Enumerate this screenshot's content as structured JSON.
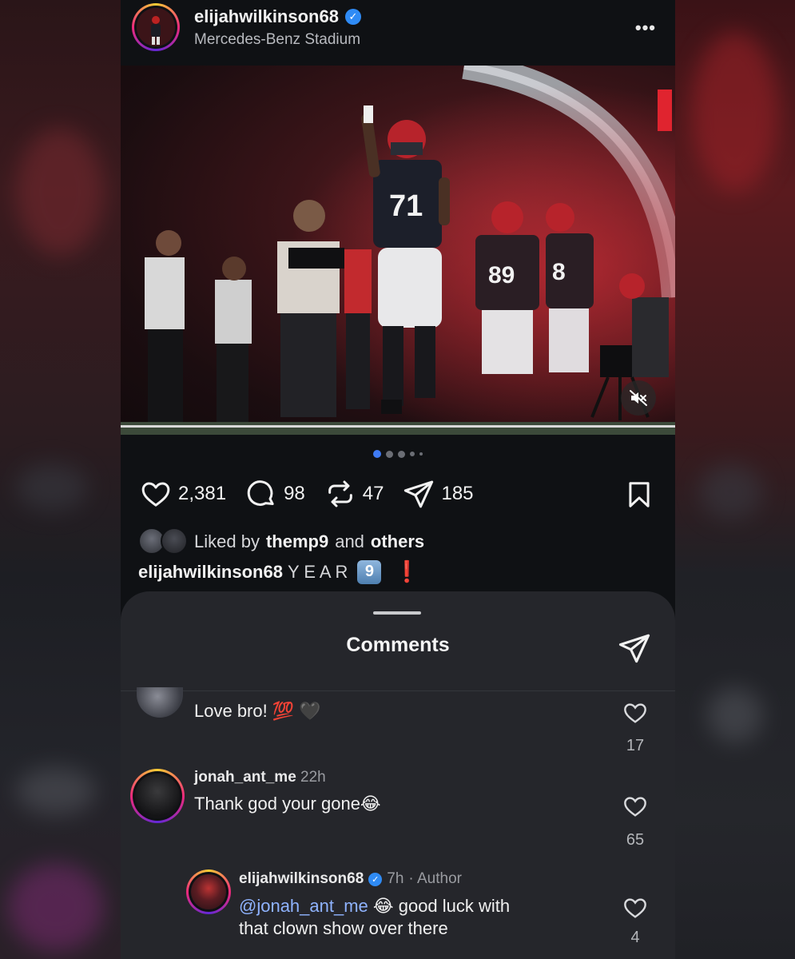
{
  "post": {
    "username": "elijahwilkinson68",
    "location": "Mercedes-Benz Stadium",
    "verified_mark": "✓",
    "more_label": "•••",
    "jersey_number": "71",
    "teammate_numbers": [
      "89",
      "8"
    ],
    "carousel": {
      "total": 5,
      "active_index": 0
    }
  },
  "actions": {
    "likes": "2,381",
    "comments": "98",
    "reposts": "47",
    "shares": "185"
  },
  "liked_by": {
    "prefix": "Liked by",
    "user": "themp9",
    "conj": "and",
    "suffix": "others"
  },
  "caption": {
    "username": "elijahwilkinson68",
    "text": "Y E A R",
    "keycap": "9",
    "emphasis": "❗"
  },
  "comments_sheet": {
    "title": "Comments",
    "items": [
      {
        "text": "Love bro! 💯 🖤",
        "likes": "17"
      },
      {
        "username": "jonah_ant_me",
        "time": "22h",
        "text": "Thank god your gone😂",
        "likes": "65"
      },
      {
        "username": "elijahwilkinson68",
        "time": "7h",
        "author_tag": "· Author",
        "mention": "@jonah_ant_me",
        "text_after_mention": "😂 good luck with",
        "text_line2": "that clown show over there",
        "likes": "4"
      }
    ]
  },
  "colors": {
    "background": "#0f1114",
    "sheet": "#25262b",
    "accent_blue": "#2f8bf5",
    "mention": "#8fb3ff",
    "danger_red": "#e0242f"
  }
}
